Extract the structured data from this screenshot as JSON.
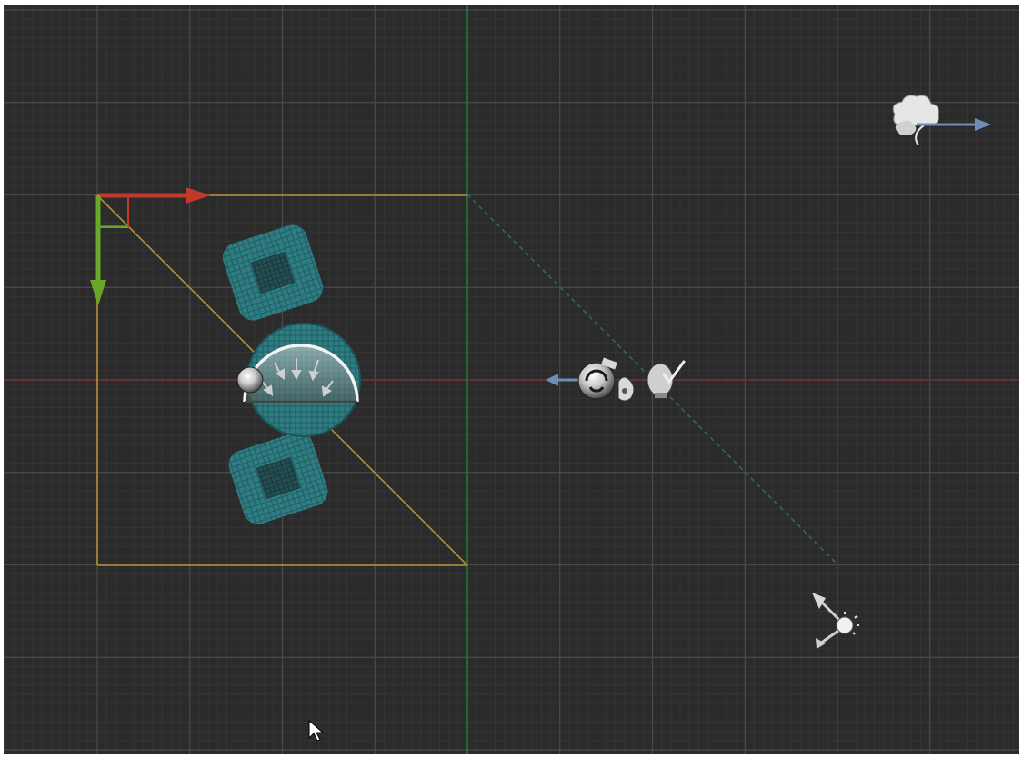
{
  "viewport": {
    "view": "top-orthographic",
    "label": "",
    "colors": {
      "background": "#2b2b2b",
      "grid_minor": "#343434",
      "grid_major": "#4a4a4a",
      "axis_x": "#8a2a2e",
      "axis_y": "#1f7a3a",
      "gizmo_x": "#c0392b",
      "gizmo_y": "#6aa82a",
      "selection": "#b8903a",
      "mesh": "#2d7b80",
      "light_arrow": "#6e8eb8",
      "camera_frustum": "#2f6a60"
    }
  },
  "scene_objects": [
    {
      "name": "box-mesh-upper",
      "type": "mesh"
    },
    {
      "name": "sphere-mesh-center",
      "type": "mesh"
    },
    {
      "name": "box-mesh-lower",
      "type": "mesh"
    },
    {
      "name": "area-light",
      "type": "light"
    },
    {
      "name": "reflection-probe",
      "type": "probe"
    },
    {
      "name": "audio-source",
      "type": "audio"
    },
    {
      "name": "directional-light",
      "type": "light"
    },
    {
      "name": "wind-zone",
      "type": "effector"
    }
  ],
  "transform_gizmo": {
    "mode": "translate",
    "axes": [
      "x",
      "y"
    ]
  },
  "cursor": "arrow-pointer"
}
